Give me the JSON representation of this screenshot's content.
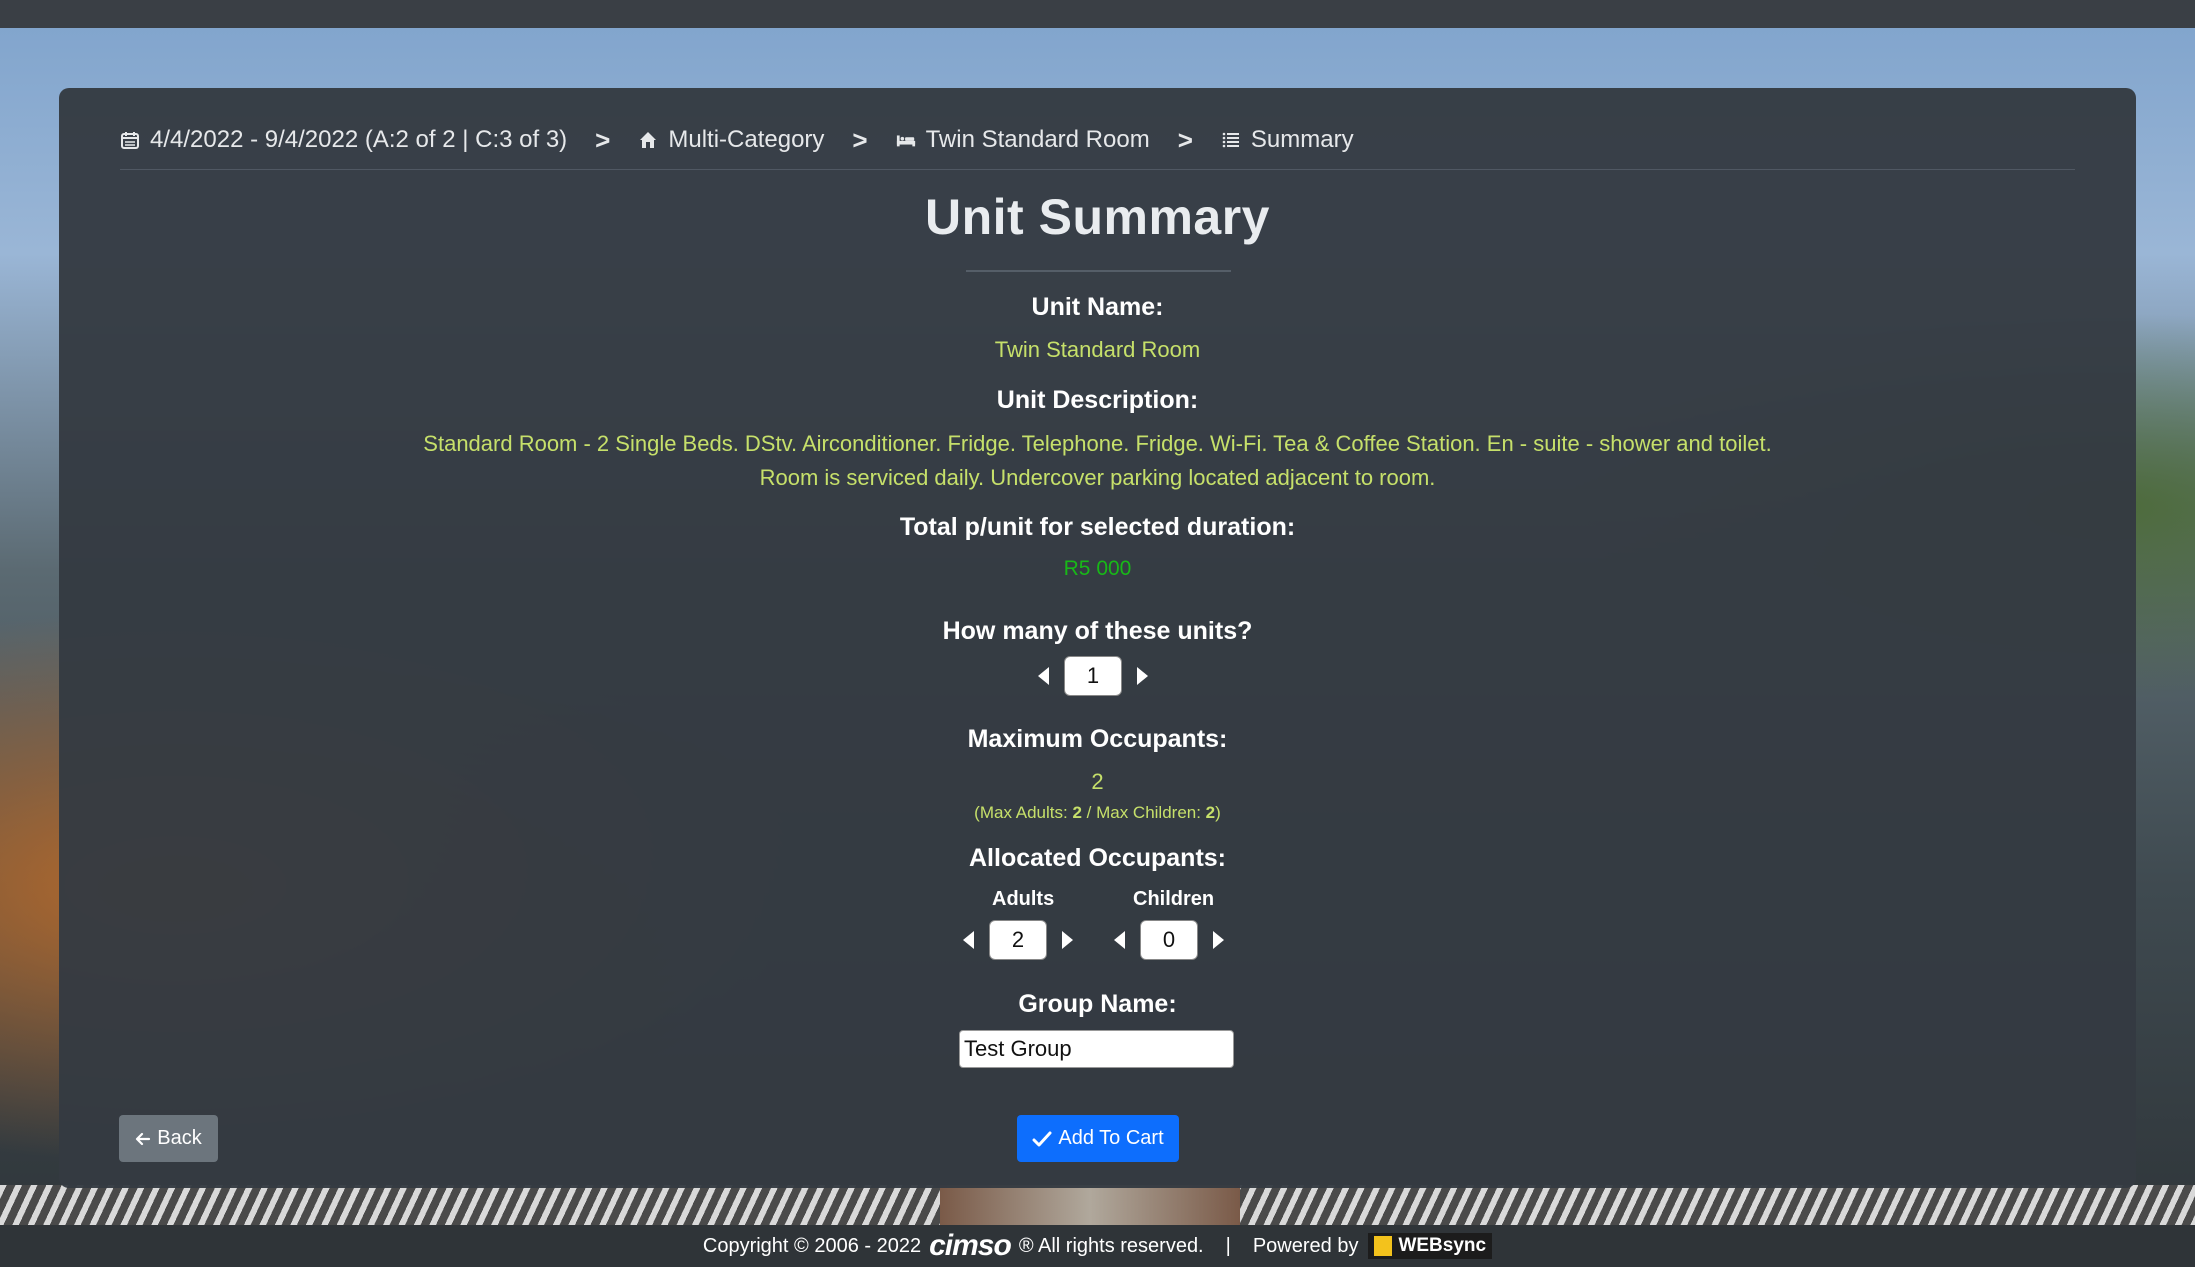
{
  "breadcrumb": {
    "dates": "4/4/2022 - 9/4/2022 (A:2 of 2 | C:3 of 3)",
    "category": "Multi-Category",
    "room": "Twin Standard Room",
    "summary": "Summary",
    "separator": ">"
  },
  "page": {
    "title": "Unit Summary"
  },
  "unit": {
    "name_label": "Unit Name:",
    "name": "Twin Standard Room",
    "description_label": "Unit Description:",
    "description": "Standard Room - 2 Single Beds. DStv. Airconditioner. Fridge. Telephone. Fridge. Wi-Fi. Tea & Coffee Station. En - suite - shower and toilet. Room is serviced daily. Undercover parking located adjacent to room.",
    "total_label": "Total p/unit for selected duration:",
    "total": "R5 000",
    "quantity_label": "How many of these units?",
    "quantity": "1",
    "max_label": "Maximum Occupants:",
    "max_occupants": "2",
    "max_breakdown_prefix": "(Max Adults: ",
    "max_adults": "2",
    "max_breakdown_mid": " / Max Children: ",
    "max_children": "2",
    "max_breakdown_suffix": ")",
    "allocated_label": "Allocated Occupants:",
    "adults_label": "Adults",
    "adults": "2",
    "children_label": "Children",
    "children": "0",
    "group_label": "Group Name:",
    "group_name": "Test Group"
  },
  "actions": {
    "back": "Back",
    "add_to_cart": "Add To Cart"
  },
  "footer": {
    "copyright": "Copyright © 2006 - 2022",
    "brand": "cimso",
    "rights": "® All rights reserved.",
    "pipe": "|",
    "powered_by": "Powered by",
    "powered_brand": "WEBsync"
  },
  "colors": {
    "accent_text": "#c6e06a",
    "price": "#18b818",
    "primary": "#0d6efd",
    "secondary": "#6c757d",
    "panel": "#343a42"
  }
}
